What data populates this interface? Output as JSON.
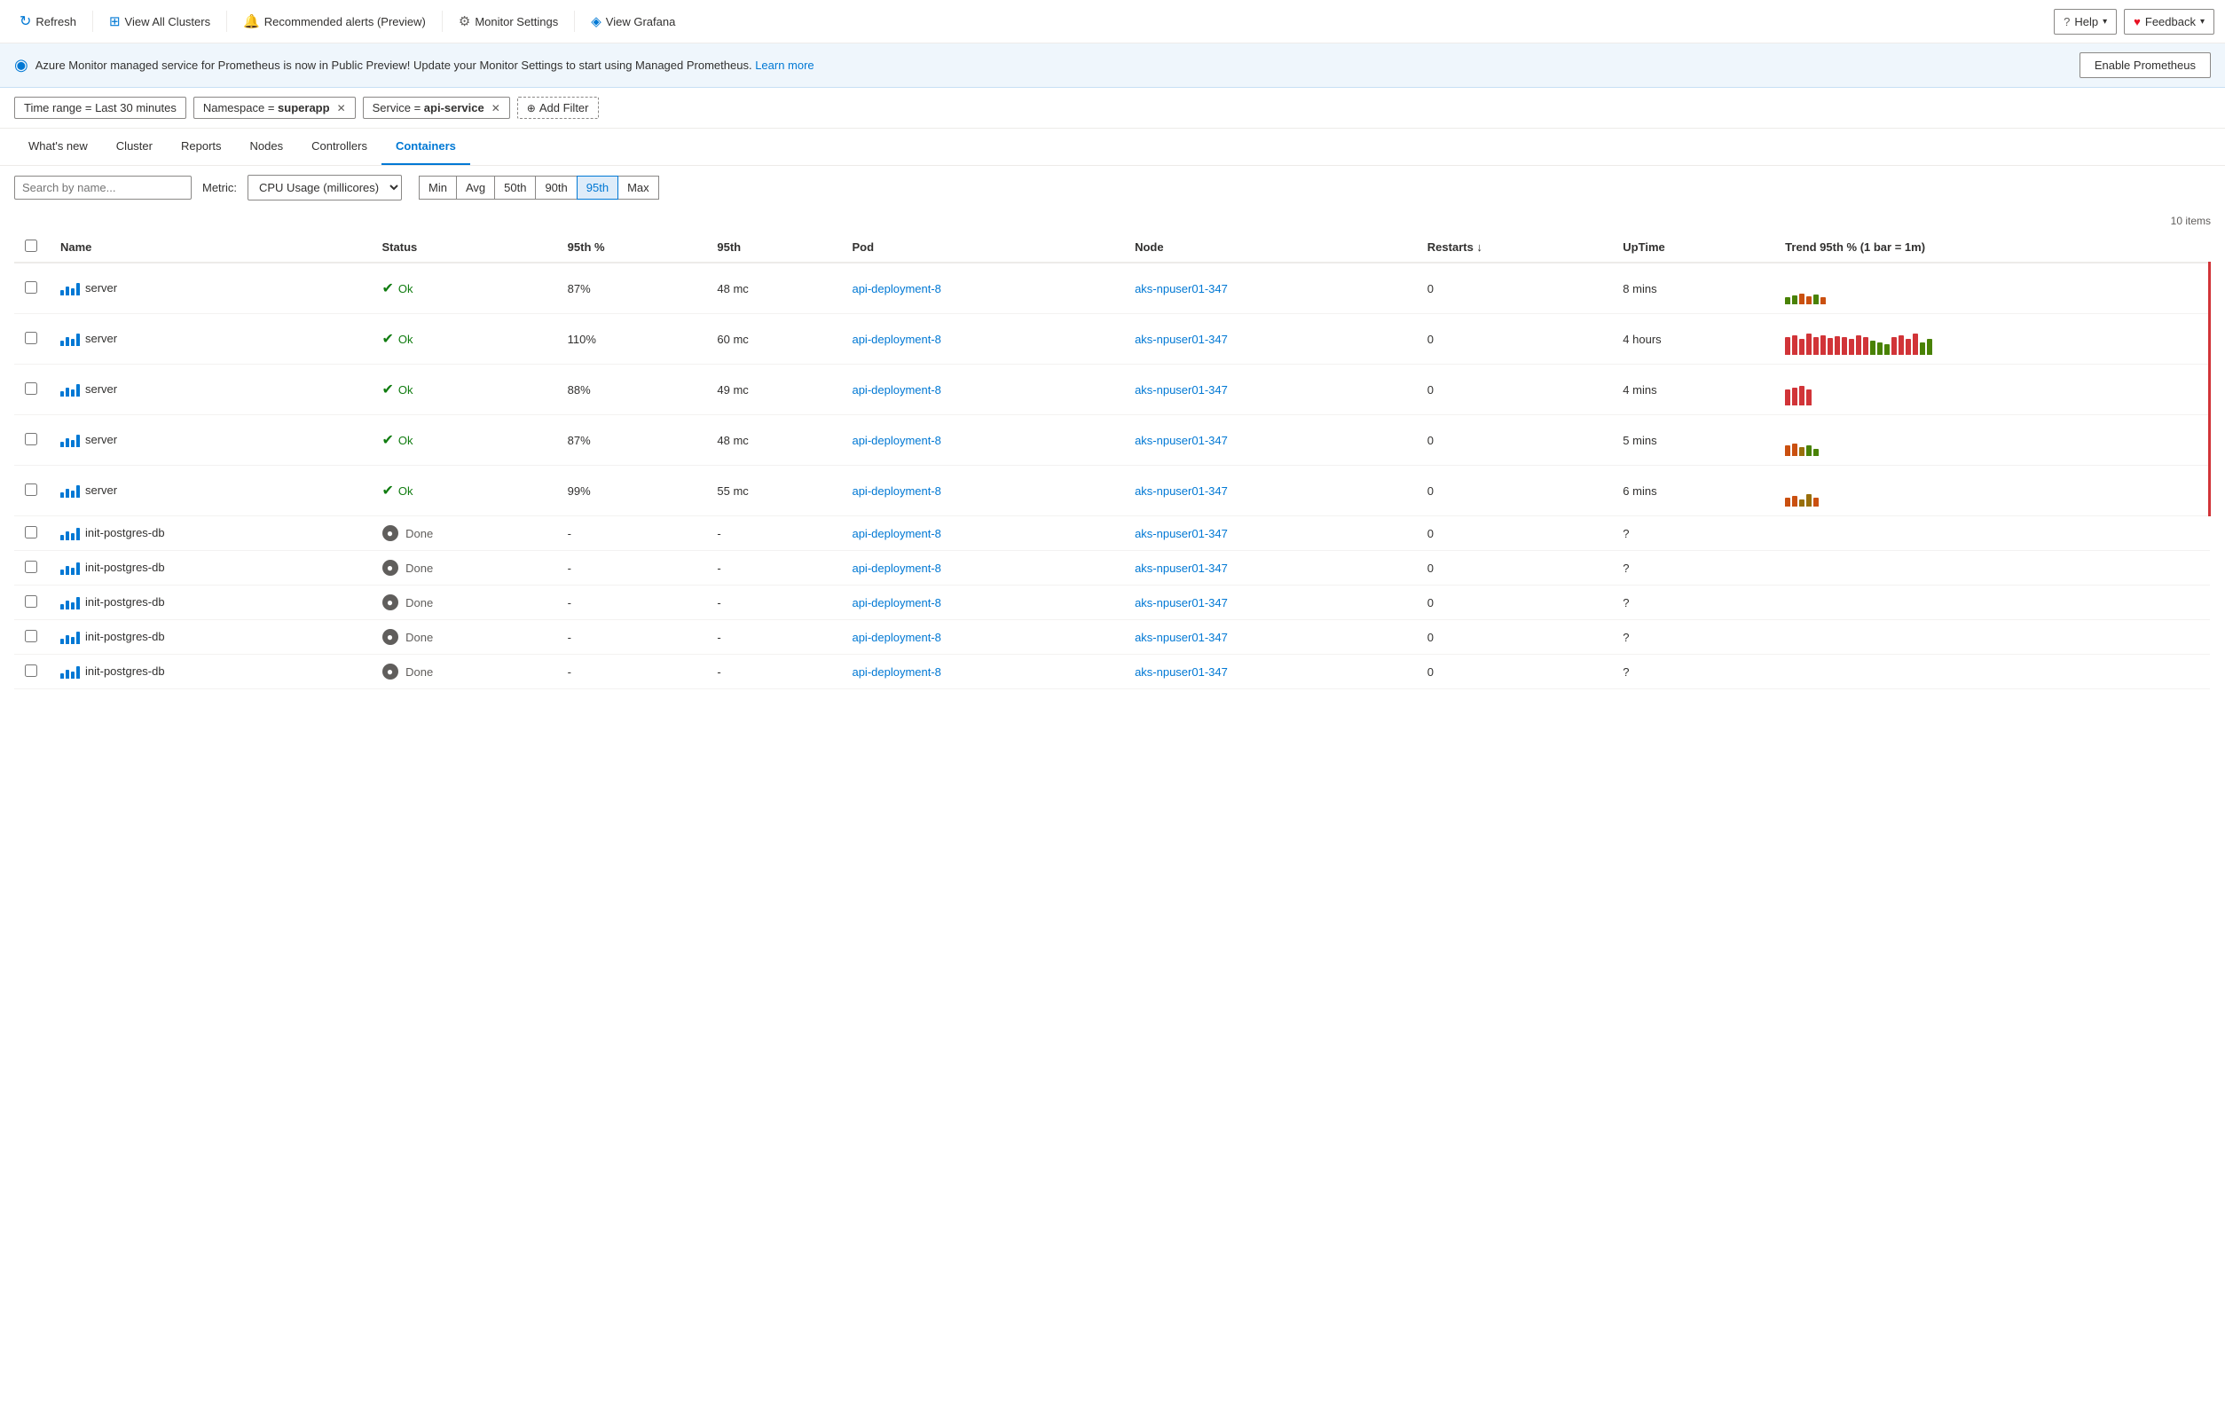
{
  "toolbar": {
    "refresh_label": "Refresh",
    "view_all_clusters_label": "View All Clusters",
    "recommended_alerts_label": "Recommended alerts (Preview)",
    "monitor_settings_label": "Monitor Settings",
    "view_grafana_label": "View Grafana",
    "help_label": "Help",
    "feedback_label": "Feedback"
  },
  "banner": {
    "text": "Azure Monitor managed service for Prometheus is now in Public Preview! Update your Monitor Settings to start using Managed Prometheus.",
    "link_text": "Learn more",
    "button_label": "Enable Prometheus"
  },
  "filters": {
    "time_range": {
      "label": "Time range = Last 30 minutes"
    },
    "namespace": {
      "label": "Namespace = ",
      "value": "superapp"
    },
    "service": {
      "label": "Service = ",
      "value": "api-service"
    },
    "add_filter_label": "Add Filter"
  },
  "nav": {
    "tabs": [
      {
        "id": "whats-new",
        "label": "What's new"
      },
      {
        "id": "cluster",
        "label": "Cluster"
      },
      {
        "id": "reports",
        "label": "Reports"
      },
      {
        "id": "nodes",
        "label": "Nodes"
      },
      {
        "id": "controllers",
        "label": "Controllers"
      },
      {
        "id": "containers",
        "label": "Containers",
        "active": true
      }
    ]
  },
  "controls": {
    "search_placeholder": "Search by name...",
    "metric_label": "Metric:",
    "metric_value": "CPU Usage (millicores)",
    "percentile_buttons": [
      {
        "id": "min",
        "label": "Min"
      },
      {
        "id": "avg",
        "label": "Avg"
      },
      {
        "id": "50th",
        "label": "50th"
      },
      {
        "id": "90th",
        "label": "90th"
      },
      {
        "id": "95th",
        "label": "95th",
        "active": true
      },
      {
        "id": "max",
        "label": "Max"
      }
    ]
  },
  "table": {
    "item_count": "10 items",
    "columns": [
      {
        "id": "name",
        "label": "Name"
      },
      {
        "id": "status",
        "label": "Status"
      },
      {
        "id": "95th_pct",
        "label": "95th %"
      },
      {
        "id": "95th",
        "label": "95th"
      },
      {
        "id": "pod",
        "label": "Pod"
      },
      {
        "id": "node",
        "label": "Node"
      },
      {
        "id": "restarts",
        "label": "Restarts ↓"
      },
      {
        "id": "uptime",
        "label": "UpTime"
      },
      {
        "id": "trend",
        "label": "Trend 95th % (1 bar = 1m)"
      }
    ],
    "rows": [
      {
        "name": "server",
        "status": "Ok",
        "status_type": "ok",
        "pct": "87%",
        "value": "48 mc",
        "pod": "api-deployment-8",
        "node": "aks-npuser01-347",
        "restarts": "0",
        "uptime": "8 mins",
        "has_trend": true,
        "trend_type": "small"
      },
      {
        "name": "server",
        "status": "Ok",
        "status_type": "ok",
        "pct": "110%",
        "value": "60 mc",
        "pod": "api-deployment-8",
        "node": "aks-npuser01-347",
        "restarts": "0",
        "uptime": "4 hours",
        "has_trend": true,
        "trend_type": "large"
      },
      {
        "name": "server",
        "status": "Ok",
        "status_type": "ok",
        "pct": "88%",
        "value": "49 mc",
        "pod": "api-deployment-8",
        "node": "aks-npuser01-347",
        "restarts": "0",
        "uptime": "4 mins",
        "has_trend": true,
        "trend_type": "small-red"
      },
      {
        "name": "server",
        "status": "Ok",
        "status_type": "ok",
        "pct": "87%",
        "value": "48 mc",
        "pod": "api-deployment-8",
        "node": "aks-npuser01-347",
        "restarts": "0",
        "uptime": "5 mins",
        "has_trend": true,
        "trend_type": "small-orange"
      },
      {
        "name": "server",
        "status": "Ok",
        "status_type": "ok",
        "pct": "99%",
        "value": "55 mc",
        "pod": "api-deployment-8",
        "node": "aks-npuser01-347",
        "restarts": "0",
        "uptime": "6 mins",
        "has_trend": true,
        "trend_type": "small-mixed"
      },
      {
        "name": "init-postgres-db",
        "status": "Done",
        "status_type": "done",
        "pct": "-",
        "value": "-",
        "pod": "api-deployment-8",
        "node": "aks-npuser01-347",
        "restarts": "0",
        "uptime": "?",
        "has_trend": false
      },
      {
        "name": "init-postgres-db",
        "status": "Done",
        "status_type": "done",
        "pct": "-",
        "value": "-",
        "pod": "api-deployment-8",
        "node": "aks-npuser01-347",
        "restarts": "0",
        "uptime": "?",
        "has_trend": false
      },
      {
        "name": "init-postgres-db",
        "status": "Done",
        "status_type": "done",
        "pct": "-",
        "value": "-",
        "pod": "api-deployment-8",
        "node": "aks-npuser01-347",
        "restarts": "0",
        "uptime": "?",
        "has_trend": false
      },
      {
        "name": "init-postgres-db",
        "status": "Done",
        "status_type": "done",
        "pct": "-",
        "value": "-",
        "pod": "api-deployment-8",
        "node": "aks-npuser01-347",
        "restarts": "0",
        "uptime": "?",
        "has_trend": false
      },
      {
        "name": "init-postgres-db",
        "status": "Done",
        "status_type": "done",
        "pct": "-",
        "value": "-",
        "pod": "api-deployment-8",
        "node": "aks-npuser01-347",
        "restarts": "0",
        "uptime": "?",
        "has_trend": false
      }
    ]
  },
  "colors": {
    "accent": "#0078d4",
    "ok_green": "#107c10",
    "done_gray": "#605e5c",
    "red": "#d13438",
    "orange": "#ca5010",
    "yellow": "#986f0b",
    "light_green": "#498205"
  }
}
